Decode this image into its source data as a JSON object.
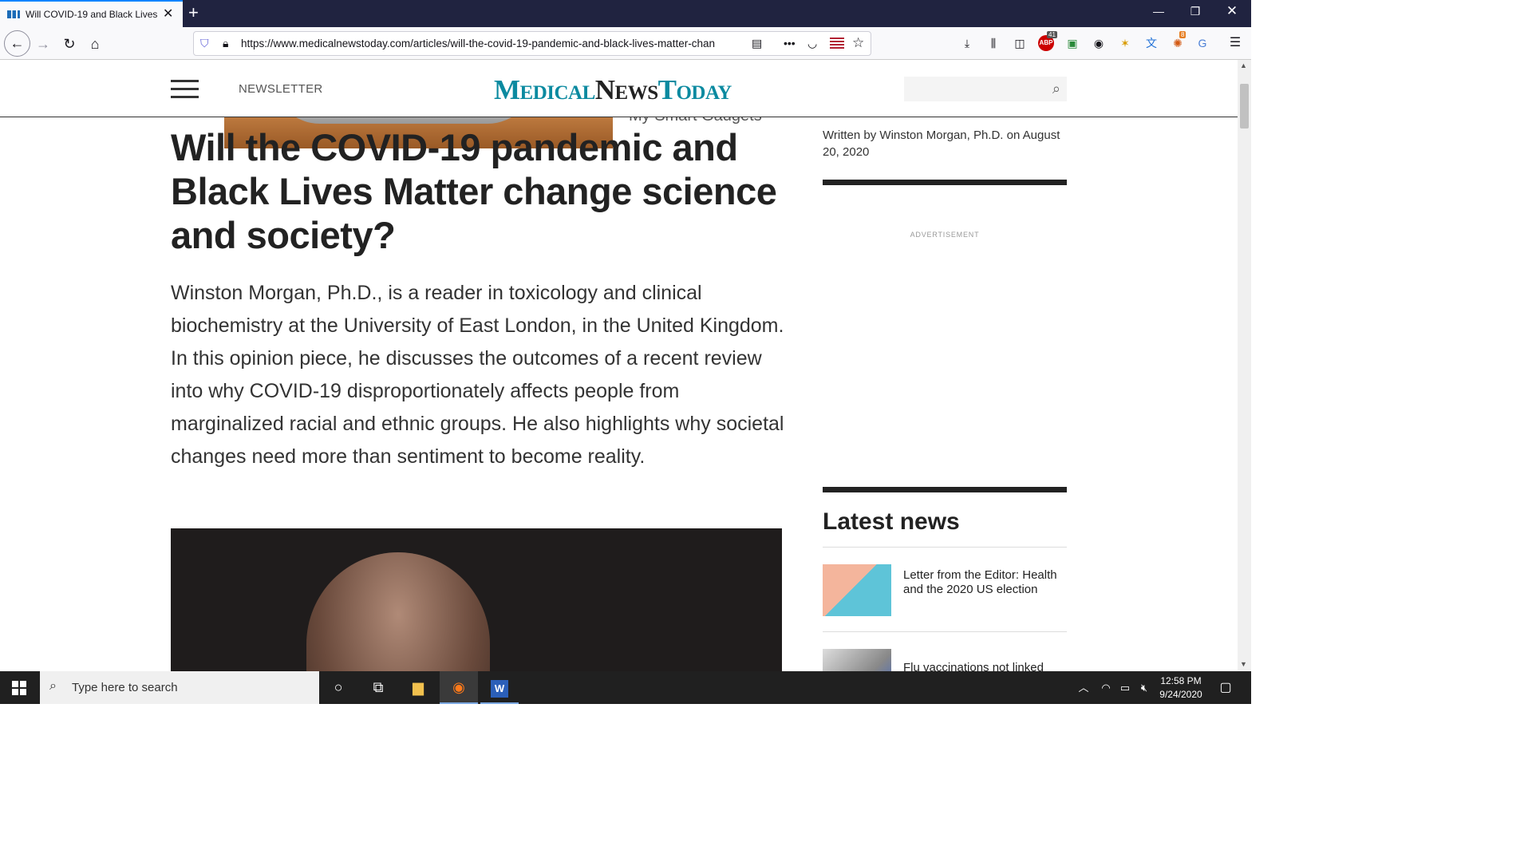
{
  "browser": {
    "tab_title": "Will COVID-19 and Black Lives",
    "new_tab_glyph": "+",
    "url": "https://www.medicalnewstoday.com/articles/will-the-covid-19-pandemic-and-black-lives-matter-chan",
    "badge_abp": "41",
    "badge_ext": "8"
  },
  "site": {
    "newsletter_label": "NEWSLETTER",
    "logo_word1": "Medical",
    "logo_word2": "News",
    "logo_word3": "Today",
    "ad_caption": "My Smart Gadgets"
  },
  "article": {
    "headline": "Will the COVID-19 pandemic and Black Lives Matter change science and society?",
    "dek": "Winston Morgan, Ph.D., is a reader in toxicology and clinical biochemistry at the University of East London, in the United Kingdom. In this opinion piece, he discusses the outcomes of a recent review into why COVID-19 disproportionately affects people from marginalized racial and ethnic groups. He also highlights why societal changes need more than sentiment to become reality."
  },
  "sidebar": {
    "byline": "Written by Winston Morgan, Ph.D. on August 20, 2020",
    "ad_label": "ADVERTISEMENT",
    "latest_title": "Latest news",
    "news": [
      {
        "title": "Letter from the Editor: Health and the 2020 US election"
      },
      {
        "title": "Flu vaccinations not linked"
      }
    ]
  },
  "taskbar": {
    "search_placeholder": "Type here to search",
    "time": "12:58 PM",
    "date": "9/24/2020"
  },
  "colors": {
    "brand_teal": "#0b8aa0",
    "tabbar": "#202340",
    "accent_blue": "#0a84ff"
  }
}
